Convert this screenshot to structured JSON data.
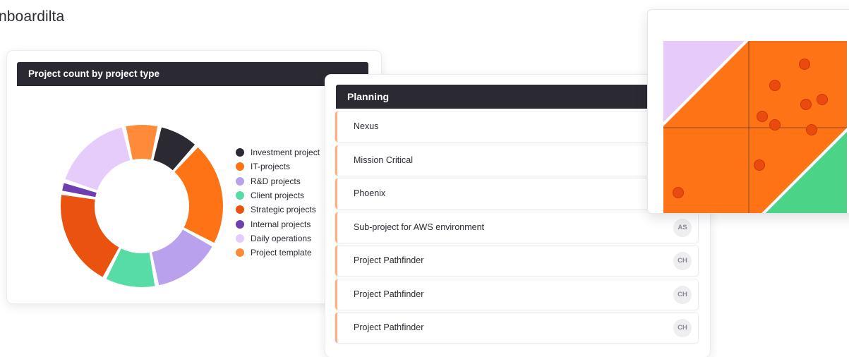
{
  "background": {
    "text": "nboardilta"
  },
  "donut_card": {
    "title": "Project count by project type",
    "legend": [
      {
        "label": "Investment project",
        "color": "#2b2a33"
      },
      {
        "label": "IT-projects",
        "color": "#fd7316"
      },
      {
        "label": "R&D projects",
        "color": "#b9a1ee"
      },
      {
        "label": "Client projects",
        "color": "#57dca5"
      },
      {
        "label": "Strategic projects",
        "color": "#ea5210"
      },
      {
        "label": "Internal projects",
        "color": "#6d3fb0"
      },
      {
        "label": "Daily operations",
        "color": "#e5ccfa"
      },
      {
        "label": "Project template",
        "color": "#fe8a3a"
      }
    ]
  },
  "chart_data": {
    "type": "pie",
    "title": "Project count by project type",
    "series": [
      {
        "name": "Investment project",
        "value": 7,
        "color": "#2b2a33"
      },
      {
        "name": "IT-projects",
        "value": 18,
        "color": "#fd7316"
      },
      {
        "name": "R&D projects",
        "value": 12,
        "color": "#b9a1ee"
      },
      {
        "name": "Client projects",
        "value": 9,
        "color": "#57dca5"
      },
      {
        "name": "Strategic projects",
        "value": 17,
        "color": "#ea5210"
      },
      {
        "name": "Internal projects",
        "value": 2,
        "color": "#6d3fb0"
      },
      {
        "name": "Daily operations",
        "value": 14,
        "color": "#e5ccfa"
      },
      {
        "name": "Project template",
        "value": 6,
        "color": "#fe8a3a"
      }
    ],
    "legend_position": "right"
  },
  "planning_card": {
    "title": "Planning",
    "rows": [
      {
        "name": "Nexus",
        "avatar": ""
      },
      {
        "name": "Mission Critical",
        "avatar": ""
      },
      {
        "name": "Phoenix",
        "avatar": ""
      },
      {
        "name": "Sub-project for AWS environment",
        "avatar": "AS"
      },
      {
        "name": "Project Pathfinder",
        "avatar": "CH"
      },
      {
        "name": "Project Pathfinder",
        "avatar": "CH"
      },
      {
        "name": "Project Pathfinder",
        "avatar": "CH"
      }
    ]
  },
  "matrix_card": {
    "colors": {
      "quadrant_top_left": "#e6cbfa",
      "main": "#fd7316",
      "quadrant_bottom_right": "#4bd487",
      "dot": "#ea4a0e"
    }
  }
}
